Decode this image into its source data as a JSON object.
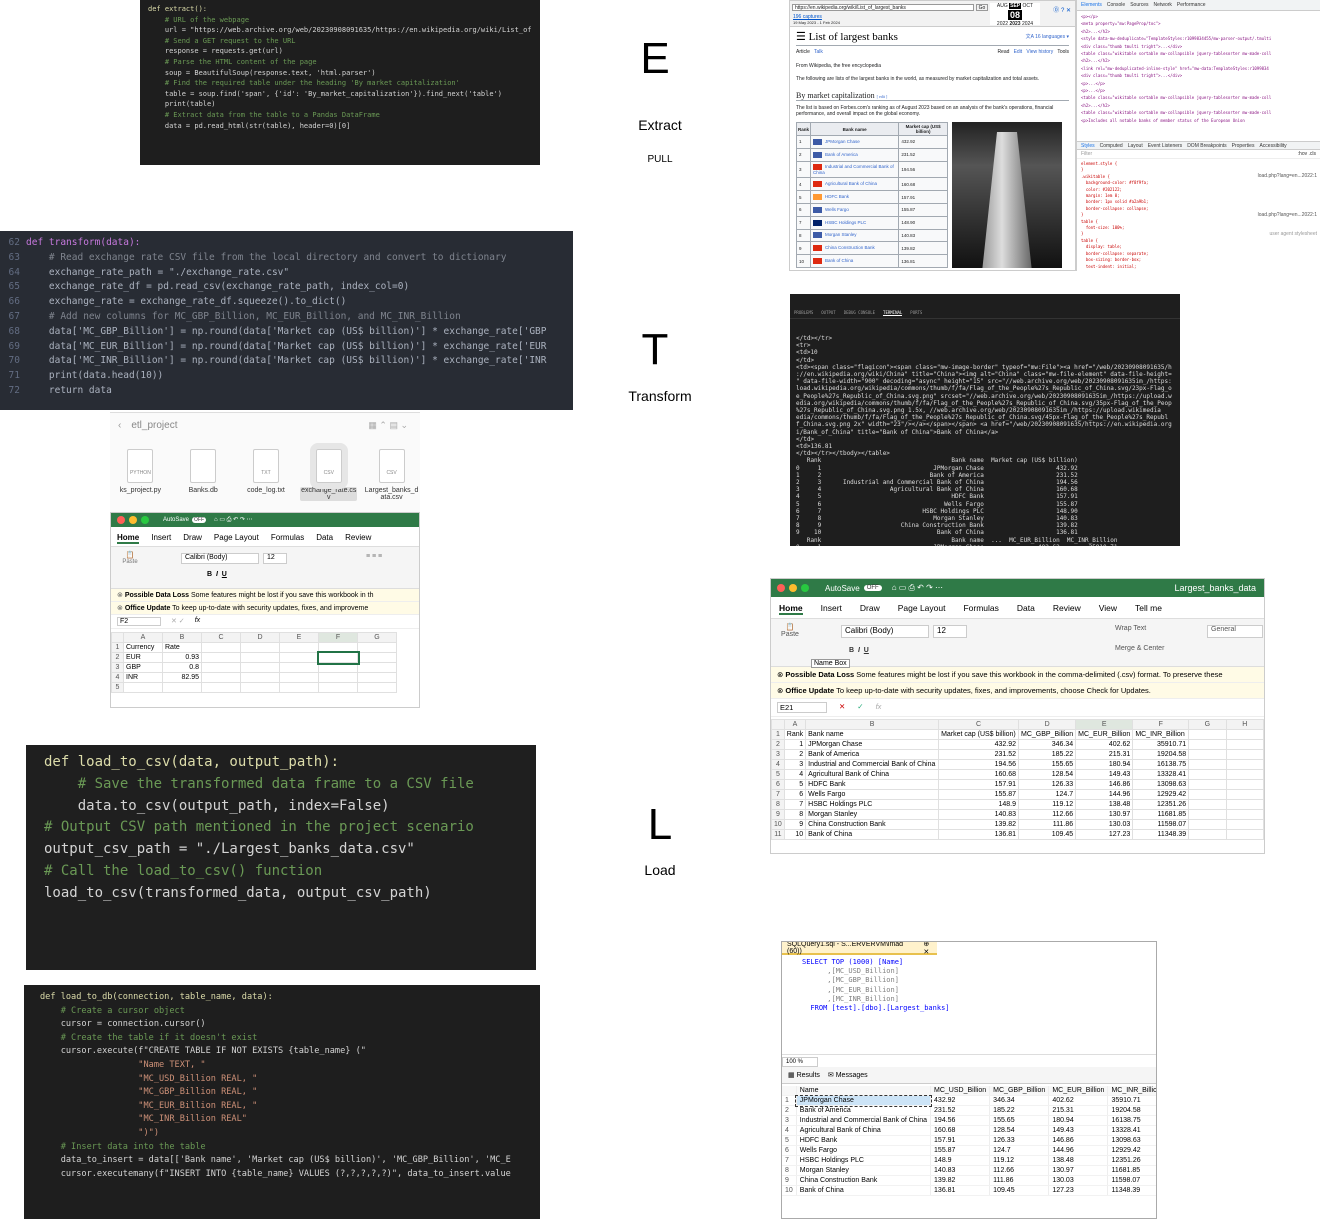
{
  "etl_letters": {
    "e": "E",
    "t": "T",
    "l": "L",
    "e_label": "Extract",
    "e_sub": "PULL",
    "t_label": "Transform",
    "l_label": "Load"
  },
  "extract_code": [
    "def extract():",
    "    # URL of the webpage",
    "    url = \"https://web.archive.org/web/20230908091635/https://en.wikipedia.org/wiki/List_of",
    "",
    "    # Send a GET request to the URL",
    "    response = requests.get(url)",
    "",
    "    # Parse the HTML content of the page",
    "    soup = BeautifulSoup(response.text, 'html.parser')",
    "",
    "    # Find the required table under the heading 'By market capitalization'",
    "    table = soup.find('span', {'id': 'By_market_capitalization'}).find_next('table')",
    "    print(table)",
    "    # Extract data from the table to a Pandas DataFrame",
    "    data = pd.read_html(str(table), header=0)[0]"
  ],
  "transform_code": {
    "line_numbers": [
      "62",
      "63",
      "64",
      "65",
      "66",
      "67",
      "68",
      "69",
      "70",
      "71",
      "72",
      ""
    ],
    "lines": [
      "def transform(data):",
      "    # Read exchange rate CSV file from the local directory and convert to dictionary",
      "    exchange_rate_path = \"./exchange_rate.csv\"",
      "    exchange_rate_df = pd.read_csv(exchange_rate_path, index_col=0)",
      "    exchange_rate = exchange_rate_df.squeeze().to_dict()",
      "",
      "    # Add new columns for MC_GBP_Billion, MC_EUR_Billion, and MC_INR_Billion",
      "    data['MC_GBP_Billion'] = np.round(data['Market cap (US$ billion)'] * exchange_rate['GBP",
      "    data['MC_EUR_Billion'] = np.round(data['Market cap (US$ billion)'] * exchange_rate['EUR",
      "    data['MC_INR_Billion'] = np.round(data['Market cap (US$ billion)'] * exchange_rate['INR",
      "    print(data.head(10))",
      "    return data"
    ]
  },
  "load_csv_code": [
    "def load_to_csv(data, output_path):",
    "    # Save the transformed data frame to a CSV file",
    "    data.to_csv(output_path, index=False)",
    "",
    "# Output CSV path mentioned in the project scenario",
    "output_csv_path = \"./Largest_banks_data.csv\"",
    "",
    "# Call the load_to_csv() function",
    "load_to_csv(transformed_data, output_csv_path)"
  ],
  "load_db_code": [
    "def load_to_db(connection, table_name, data):",
    "    # Create a cursor object",
    "    cursor = connection.cursor()",
    "",
    "    # Create the table if it doesn't exist",
    "    cursor.execute(f\"CREATE TABLE IF NOT EXISTS {table_name} (\"",
    "                   \"Name TEXT, \"",
    "                   \"MC_USD_Billion REAL, \"",
    "                   \"MC_GBP_Billion REAL, \"",
    "                   \"MC_EUR_Billion REAL, \"",
    "                   \"MC_INR_Billion REAL\"",
    "                   \")\")",
    "",
    "    # Insert data into the table",
    "    data_to_insert = data[['Bank name', 'Market cap (US$ billion)', 'MC_GBP_Billion', 'MC_E",
    "    cursor.executemany(f\"INSERT INTO {table_name} VALUES (?,?,?,?,?)\", data_to_insert.value"
  ],
  "finder": {
    "title": "etl_project",
    "files": [
      {
        "name": "ks_project.py",
        "tag": "PYTHON"
      },
      {
        "name": "Banks.db",
        "tag": ""
      },
      {
        "name": "code_log.txt",
        "tag": "TXT"
      },
      {
        "name": "exchange_rate.cs\nv",
        "tag": "CSV"
      },
      {
        "name": "Largest_banks_d\nata.csv",
        "tag": "CSV"
      }
    ],
    "partial_file": "s_proje\nL.py"
  },
  "excel_small": {
    "autosave": "AutoSave",
    "autosave_state": "OFF",
    "tabs": [
      "Home",
      "Insert",
      "Draw",
      "Page Layout",
      "Formulas",
      "Data",
      "Review"
    ],
    "font": "Calibri (Body)",
    "size": "12",
    "paste": "Paste",
    "notice1_title": "Possible Data Loss",
    "notice1_text": "Some features might be lost if you save this workbook in th",
    "notice2_title": "Office Update",
    "notice2_text": "To keep up-to-date with security updates, fixes, and improveme",
    "cell": "F2",
    "fx": "fx",
    "cols": [
      "A",
      "B",
      "C",
      "D",
      "E",
      "F",
      "G"
    ],
    "rows": [
      [
        "1",
        "Currency",
        "Rate"
      ],
      [
        "2",
        "EUR",
        "0.93"
      ],
      [
        "3",
        "GBP",
        "0.8"
      ],
      [
        "4",
        "INR",
        "82.95"
      ],
      [
        "5",
        "",
        ""
      ]
    ]
  },
  "wiki": {
    "url": "https://en.wikipedia.org/wiki/List_of_largest_banks",
    "go": "Go",
    "captures": "196 captures",
    "capture_range": "19 May 2023 - 1 Feb 2024",
    "months": [
      "AUG",
      "SEP",
      "OCT"
    ],
    "day": "08",
    "year": "2022",
    "year2": "2023",
    "year3": "2024",
    "title": "List of largest banks",
    "languages": "16 languages",
    "tabs": [
      "Article",
      "Talk"
    ],
    "actions": [
      "Read",
      "Edit",
      "View history",
      "Tools"
    ],
    "from": "From Wikipedia, the free encyclopedia",
    "intro": "The following are lists of the largest banks in the world, as measured by market capitalization and total assets.",
    "section": "By market capitalization",
    "edit": "[ edit ]",
    "desc": "The list is based on Forbes.com's ranking as of August 2023 based on an analysis of the bank's operations, financial performance, and overall impact on the global economy.",
    "headers": [
      "Rank",
      "Bank name",
      "Market cap (US$ billion)"
    ],
    "rows": [
      [
        "1",
        "JPMorgan Chase",
        "432.92"
      ],
      [
        "2",
        "Bank of America",
        "231.52"
      ],
      [
        "3",
        "Industrial and Commercial Bank of China",
        "194.56"
      ],
      [
        "4",
        "Agricultural Bank of China",
        "160.68"
      ],
      [
        "5",
        "HDFC Bank",
        "157.91"
      ],
      [
        "6",
        "Wells Fargo",
        "155.87"
      ],
      [
        "7",
        "HSBC Holdings PLC",
        "148.90"
      ],
      [
        "8",
        "Morgan Stanley",
        "140.83"
      ],
      [
        "9",
        "China Construction Bank",
        "139.82"
      ],
      [
        "10",
        "Bank of China",
        "136.81"
      ]
    ],
    "flag_colors": [
      "#3c5aa6",
      "#3c5aa6",
      "#de2910",
      "#de2910",
      "#ff9933",
      "#3c5aa6",
      "#012169",
      "#3c5aa6",
      "#de2910",
      "#de2910"
    ]
  },
  "devtools": {
    "tabs": [
      "Elements",
      "Console",
      "Sources",
      "Network",
      "Performance"
    ],
    "subtabs": [
      "Styles",
      "Computed",
      "Layout",
      "Event Listeners",
      "DOM Breakpoints",
      "Properties",
      "Accessibility"
    ],
    "filter": "Filter",
    "hov": ":hov .cls",
    "lines": [
      "<p></p>",
      "<meta property=\"mw:PageProp/toc\">",
      "<h2>...</h2>",
      "<style data-mw-deduplicate=\"TemplateStyles:r1099834455/mw-parser-output/.tmulti",
      "<div class=\"thumb tmulti tright\">...</div>",
      "<table class=\"wikitable sortable mw-collapsible jquery-tablesorter mw-made-coll",
      "<h2>...</h2>",
      "<link rel=\"mw-deduplicated-inline-style\" href=\"mw-data:TemplateStyles:r1099834",
      "<div class=\"thumb tmulti tright\">...</div>",
      "<p>...</p>",
      "<p>...</p>",
      "<table class=\"wikitable sortable mw-collapsible jquery-tablesorter mw-made-coll",
      "<h2>...</h2>",
      "<table class=\"wikitable sortable mw-collapsible jquery-tablesorter mw-made-coll",
      "<p>Includes all notable banks of member status of the European Union"
    ],
    "css": [
      "element.style {",
      "}",
      ".wikitable {",
      "  background-color: #f8f9fa;",
      "  color: #202122;",
      "  margin: 1em 0;",
      "  border: 1px solid #a2a9b1;",
      "  border-collapse: collapse;",
      "}",
      "table {",
      "  font-size: 100%;",
      "}",
      "table {",
      "  display: table;",
      "  border-collapse: separate;",
      "  box-sizing: border-box;",
      "  text-indent: initial;"
    ],
    "source1": "load.php?lang=en...2022:1",
    "source2": "load.php?lang=en...2022:1",
    "source3": "user agent stylesheet"
  },
  "terminal": {
    "tabs": [
      "PROBLEMS",
      "OUTPUT",
      "DEBUG CONSOLE",
      "TERMINAL",
      "PORTS"
    ],
    "lines": [
      "</td></tr>",
      "<tr>",
      "<td>10",
      "</td>",
      "<td><span class=\"flagicon\"><span class=\"mw-image-border\" typeof=\"mw:File\"><a href=\"/web/20230908091635/h",
      "://en.wikipedia.org/wiki/China\" title=\"China\"><img alt=\"China\" class=\"mw-file-element\" data-file-height=",
      "\" data-file-width=\"900\" decoding=\"async\" height=\"15\" src=\"//web.archive.org/web/20230908091635im_/https:",
      "load.wikipedia.org/wikipedia/commons/thumb/f/fa/Flag_of_the_People%27s_Republic_of_China.svg/23px-Flag_o",
      "e_People%27s_Republic_of_China.svg.png\" srcset=\"//web.archive.org/web/20230908091635im_/https://upload.w",
      "edia.org/wikipedia/commons/thumb/f/fa/Flag_of_the_People%27s_Republic_of_China.svg/35px-Flag_of_the_Peop",
      "%27s_Republic_of_China.svg.png 1.5x, //web.archive.org/web/20230908091635im_/https://upload.wikimedia",
      "edia/commons/thumb/f/fa/Flag_of_the_People%27s_Republic_of_China.svg/45px-Flag_of_the_People%27s_Republ",
      "f_China.svg.png 2x\" width=\"23\"/></a></span></span> <a href=\"/web/20230908091635/https://en.wikipedia.org",
      "i/Bank_of_China\" title=\"Bank of China\">Bank of China</a>",
      "</td>",
      "<td>136.81",
      "</td></tr></tbody></table>",
      "   Rank                                    Bank name  Market cap (US$ billion)",
      "0     1                               JPMorgan Chase                    432.92",
      "1     2                              Bank of America                    231.52",
      "2     3      Industrial and Commercial Bank of China                    194.56",
      "3     4                   Agricultural Bank of China                    160.68",
      "4     5                                    HDFC Bank                    157.91",
      "5     6                                  Wells Fargo                    155.87",
      "6     7                            HSBC Holdings PLC                    148.90",
      "7     8                               Morgan Stanley                    140.83",
      "8     9                      China Construction Bank                    139.82",
      "9    10                                Bank of China                    136.81",
      "   Rank                                    Bank name  ...  MC_EUR_Billion  MC_INR_Billion",
      "0     1                               JPMorgan Chase  ...          402.62        35910.71",
      "1     2                              Bank of America  ...          215.31        19204.58",
      "2     3      Industrial and Commercial Bank of China  ...          180.94        16138.75"
    ]
  },
  "excel_big": {
    "autosave": "AutoSave",
    "autosave_state": "OFF",
    "title": "Largest_banks_data",
    "tabs": [
      "Home",
      "Insert",
      "Draw",
      "Page Layout",
      "Formulas",
      "Data",
      "Review",
      "View",
      "Tell me"
    ],
    "font": "Calibri (Body)",
    "size": "12",
    "paste": "Paste",
    "wrap": "Wrap Text",
    "merge": "Merge & Center",
    "format": "General",
    "tooltip": "Name Box",
    "notice1_title": "Possible Data Loss",
    "notice1_text": "Some features might be lost if you save this workbook in the comma-delimited (.csv) format. To preserve these",
    "notice2_title": "Office Update",
    "notice2_text": "To keep up-to-date with security updates, fixes, and improvements, choose Check for Updates.",
    "cell": "E21",
    "cols": [
      "A",
      "B",
      "C",
      "D",
      "E",
      "F",
      "G",
      "H"
    ],
    "headers": [
      "Rank",
      "Bank name",
      "Market cap (US$ billion)",
      "MC_GBP_Billion",
      "MC_EUR_Billion",
      "MC_INR_Billion"
    ],
    "rows": [
      [
        "1",
        "JPMorgan Chase",
        "432.92",
        "346.34",
        "402.62",
        "35910.71"
      ],
      [
        "2",
        "Bank of America",
        "231.52",
        "185.22",
        "215.31",
        "19204.58"
      ],
      [
        "3",
        "Industrial and Commercial Bank of China",
        "194.56",
        "155.65",
        "180.94",
        "16138.75"
      ],
      [
        "4",
        "Agricultural Bank of China",
        "160.68",
        "128.54",
        "149.43",
        "13328.41"
      ],
      [
        "5",
        "HDFC Bank",
        "157.91",
        "126.33",
        "146.86",
        "13098.63"
      ],
      [
        "6",
        "Wells Fargo",
        "155.87",
        "124.7",
        "144.96",
        "12929.42"
      ],
      [
        "7",
        "HSBC Holdings PLC",
        "148.9",
        "119.12",
        "138.48",
        "12351.26"
      ],
      [
        "8",
        "Morgan Stanley",
        "140.83",
        "112.66",
        "130.97",
        "11681.85"
      ],
      [
        "9",
        "China Construction Bank",
        "139.82",
        "111.86",
        "130.03",
        "11598.07"
      ],
      [
        "10",
        "Bank of China",
        "136.81",
        "109.45",
        "127.23",
        "11348.39"
      ]
    ]
  },
  "ssms": {
    "tab": "SQLQuery1.sql - S...ERVERVM\\imad (60))",
    "query": [
      "SELECT TOP (1000) [Name]",
      "      ,[MC_USD_Billion]",
      "      ,[MC_GBP_Billion]",
      "      ,[MC_EUR_Billion]",
      "      ,[MC_INR_Billion]",
      "  FROM [test].[dbo].[Largest_banks]"
    ],
    "zoom": "100 %",
    "results_tab": "Results",
    "messages_tab": "Messages",
    "headers": [
      "Name",
      "MC_USD_Billion",
      "MC_GBP_Billion",
      "MC_EUR_Billion",
      "MC_INR_Billion"
    ],
    "rows": [
      [
        "JPMorgan Chase",
        "432.92",
        "346.34",
        "402.62",
        "35910.71"
      ],
      [
        "Bank of America",
        "231.52",
        "185.22",
        "215.31",
        "19204.58"
      ],
      [
        "Industrial and Commercial Bank of China",
        "194.56",
        "155.65",
        "180.94",
        "16138.75"
      ],
      [
        "Agricultural Bank of China",
        "160.68",
        "128.54",
        "149.43",
        "13328.41"
      ],
      [
        "HDFC Bank",
        "157.91",
        "126.33",
        "146.86",
        "13098.63"
      ],
      [
        "Wells Fargo",
        "155.87",
        "124.7",
        "144.96",
        "12929.42"
      ],
      [
        "HSBC Holdings PLC",
        "148.9",
        "119.12",
        "138.48",
        "12351.26"
      ],
      [
        "Morgan Stanley",
        "140.83",
        "112.66",
        "130.97",
        "11681.85"
      ],
      [
        "China Construction Bank",
        "139.82",
        "111.86",
        "130.03",
        "11598.07"
      ],
      [
        "Bank of China",
        "136.81",
        "109.45",
        "127.23",
        "11348.39"
      ]
    ]
  }
}
